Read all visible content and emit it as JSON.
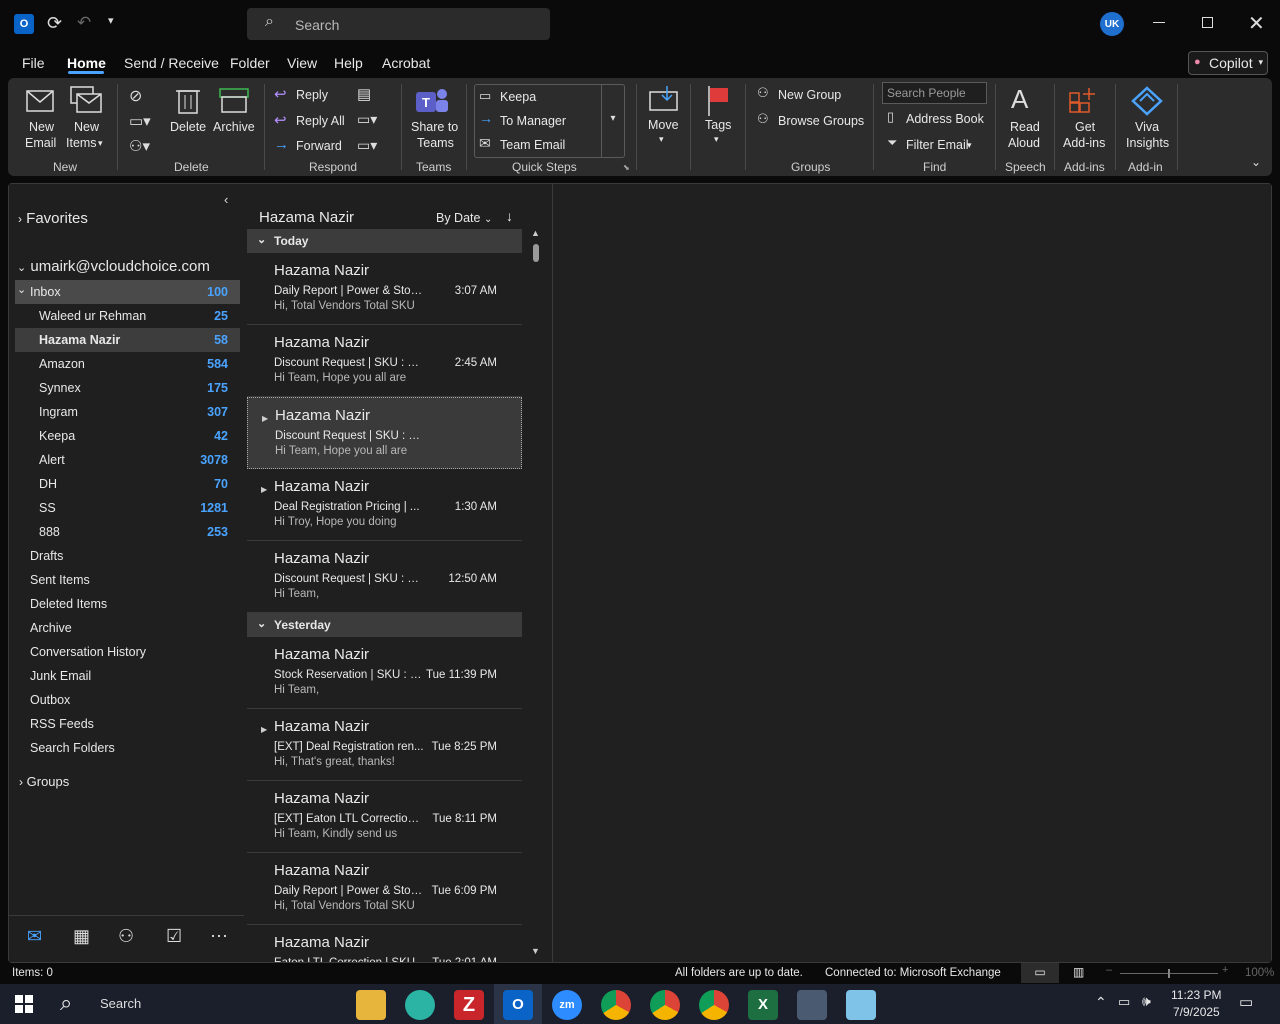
{
  "window": {
    "search_placeholder": "Search",
    "avatar_initials": "UK"
  },
  "menu": {
    "file": "File",
    "home": "Home",
    "send_receive": "Send / Receive",
    "folder": "Folder",
    "view": "View",
    "help": "Help",
    "acrobat": "Acrobat",
    "copilot": "Copilot"
  },
  "ribbon": {
    "new_email": [
      "New",
      "Email"
    ],
    "new_items": [
      "New",
      "Items"
    ],
    "delete": "Delete",
    "archive": "Archive",
    "reply": "Reply",
    "reply_all": "Reply All",
    "forward": "Forward",
    "share_teams": [
      "Share to",
      "Teams"
    ],
    "qs_keepa": "Keepa",
    "qs_manager": "To Manager",
    "qs_team": "Team Email",
    "move": "Move",
    "tags": "Tags",
    "new_group": "New Group",
    "browse_groups": "Browse Groups",
    "search_people": "Search People",
    "address_book": "Address Book",
    "filter_email": "Filter Email",
    "read_aloud": [
      "Read",
      "Aloud"
    ],
    "get_addins": [
      "Get",
      "Add-ins"
    ],
    "viva": [
      "Viva",
      "Insights"
    ],
    "groups": {
      "new": "New",
      "delete": "Delete",
      "respond": "Respond",
      "teams": "Teams",
      "quick_steps": "Quick Steps",
      "groups": "Groups",
      "find": "Find",
      "speech": "Speech",
      "addins": "Add-ins",
      "addin": "Add-in"
    }
  },
  "nav": {
    "favorites": "Favorites",
    "account": "umairk@vcloudchoice.com",
    "inbox": {
      "label": "Inbox",
      "count": "100"
    },
    "subfolders": [
      {
        "label": "Waleed ur Rehman",
        "count": "25"
      },
      {
        "label": "Hazama Nazir",
        "count": "58"
      },
      {
        "label": "Amazon",
        "count": "584"
      },
      {
        "label": "Synnex",
        "count": "175"
      },
      {
        "label": "Ingram",
        "count": "307"
      },
      {
        "label": "Keepa",
        "count": "42"
      },
      {
        "label": "Alert",
        "count": "3078"
      },
      {
        "label": "DH",
        "count": "70"
      },
      {
        "label": "SS",
        "count": "1281"
      },
      {
        "label": "888",
        "count": "253"
      }
    ],
    "folders": [
      "Drafts",
      "Sent Items",
      "Deleted Items",
      "Archive",
      "Conversation History",
      "Junk Email",
      "Outbox",
      "RSS Feeds",
      "Search Folders"
    ],
    "groups": "Groups"
  },
  "list": {
    "folder_name": "Hazama Nazir",
    "sort": "By Date",
    "today": "Today",
    "yesterday": "Yesterday",
    "messages": [
      {
        "from": "Hazama Nazir",
        "subject": "Daily Report | Power & Storage",
        "time": "3:07 AM",
        "preview": "Hi,  Total Vendors  Total SKU"
      },
      {
        "from": "Hazama Nazir",
        "subject": "Discount Request | SKU : S...",
        "time": "2:45 AM",
        "preview": "Hi Team,  Hope you all are"
      },
      {
        "from": "Hazama Nazir",
        "subject": "Discount Request | SKU : S...",
        "time": "",
        "preview": "Hi Team,  Hope you all are"
      },
      {
        "from": "Hazama Nazir",
        "subject": "Deal Registration Pricing | ...",
        "time": "1:30 AM",
        "preview": "Hi Troy,  Hope you doing"
      },
      {
        "from": "Hazama Nazir",
        "subject": "Discount Request | SKU : S...",
        "time": "12:50 AM",
        "preview": "Hi Team,"
      },
      {
        "from": "Hazama Nazir",
        "subject": "Stock Reservation | SKU : S...",
        "time": "Tue 11:39 PM",
        "preview": "Hi Team,"
      },
      {
        "from": "Hazama Nazir",
        "subject": "[EXT] Deal Registration ren...",
        "time": "Tue 8:25 PM",
        "preview": "Hi,  That's great, thanks!"
      },
      {
        "from": "Hazama Nazir",
        "subject": "[EXT] Eaton LTL Correction |...",
        "time": "Tue 8:11 PM",
        "preview": "Hi Team,  Kindly send us"
      },
      {
        "from": "Hazama Nazir",
        "subject": "Daily Report | Power & Storage",
        "time": "Tue 6:09 PM",
        "preview": "Hi,  Total Vendors  Total SKU"
      },
      {
        "from": "Hazama Nazir",
        "subject": "Eaton LTL Correction | SKU",
        "time": "Tue 2:01 AM",
        "preview": ""
      }
    ]
  },
  "status": {
    "items": "Items: 0",
    "sync": "All folders are up to date.",
    "connection": "Connected to: Microsoft Exchange",
    "zoom": "100%"
  },
  "taskbar": {
    "search": "Search",
    "time": "11:23 PM",
    "date": "7/9/2025"
  }
}
